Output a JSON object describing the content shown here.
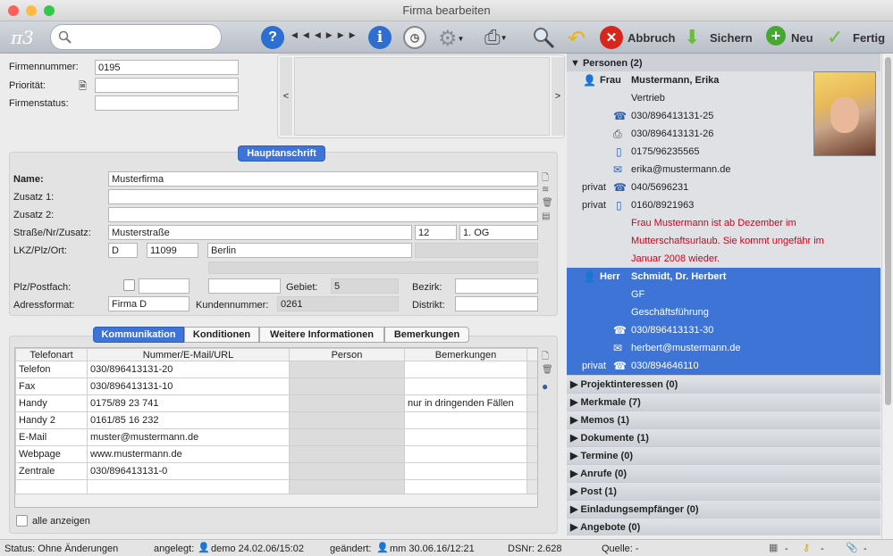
{
  "window": {
    "title": "Firma bearbeiten"
  },
  "toolbar": {
    "logo": "π3",
    "abort": "Abbruch",
    "save": "Sichern",
    "new": "Neu",
    "done": "Fertig"
  },
  "form": {
    "firmennummer_label": "Firmennummer:",
    "firmennummer": "0195",
    "prioritaet_label": "Priorität:",
    "prioritaet": "",
    "firmenstatus_label": "Firmenstatus:",
    "firmenstatus": "",
    "carousel_prev": "<",
    "carousel_next": ">"
  },
  "address": {
    "header": "Hauptanschrift",
    "name_label": "Name:",
    "name": "Musterfirma",
    "zusatz1_label": "Zusatz 1:",
    "zusatz2_label": "Zusatz 2:",
    "strasse_label": "Straße/Nr/Zusatz:",
    "strasse": "Musterstraße",
    "nr": "12",
    "zusatz": "1. OG",
    "lkz_label": "LKZ/Plz/Ort:",
    "lkz": "D",
    "plz": "11099",
    "ort": "Berlin",
    "postfach_label": "Plz/Postfach:",
    "gebiet_label": "Gebiet:",
    "gebiet": "5",
    "bezirk_label": "Bezirk:",
    "format_label": "Adressformat:",
    "format": "Firma D",
    "kundennr_label": "Kundennummer:",
    "kundennr": "0261",
    "distrikt_label": "Distrikt:"
  },
  "tabs": [
    "Kommunikation",
    "Konditionen",
    "Weitere Informationen",
    "Bemerkungen"
  ],
  "comm": {
    "headers": [
      "Telefonart",
      "Nummer/E-Mail/URL",
      "Person",
      "Bemerkungen"
    ],
    "rows": [
      [
        "Telefon",
        "030/896413131-20",
        "",
        ""
      ],
      [
        "Fax",
        "030/896413131-10",
        "",
        ""
      ],
      [
        "Handy",
        "0175/89 23 741",
        "",
        "nur in dringenden Fällen"
      ],
      [
        "Handy 2",
        "0161/85 16 232",
        "",
        ""
      ],
      [
        "E-Mail",
        "muster@mustermann.de",
        "",
        ""
      ],
      [
        "Webpage",
        "www.mustermann.de",
        "",
        ""
      ],
      [
        "Zentrale",
        "030/896413131-0",
        "",
        ""
      ],
      [
        "",
        "",
        "",
        ""
      ]
    ],
    "show_all": "alle anzeigen"
  },
  "persons": {
    "header": "Personen (2)",
    "p1": {
      "salutation": "Frau",
      "name": "Mustermann, Erika",
      "dept": "Vertrieb",
      "phone": "030/896413131-25",
      "fax": "030/896413131-26",
      "mobile": "0175/96235565",
      "email": "erika@mustermann.de",
      "priv_label": "privat",
      "priv_phone": "040/5696231",
      "priv_mobile": "0160/8921963",
      "note1": "Frau Mustermann ist ab Dezember im",
      "note2": "Mutterschaftsurlaub. Sie kommt ungefähr im",
      "note3": "Januar 2008 wieder."
    },
    "p2": {
      "salutation": "Herr",
      "name": "Schmidt, Dr. Herbert",
      "role": "GF",
      "dept": "Geschäftsführung",
      "phone": "030/896413131-30",
      "email": "herbert@mustermann.de",
      "priv_label": "privat",
      "priv_phone": "030/894646110"
    }
  },
  "sections": [
    "Projektinteressen (0)",
    "Merkmale (7)",
    "Memos (1)",
    "Dokumente (1)",
    "Termine (0)",
    "Anrufe (0)",
    "Post (1)",
    "Einladungsempfänger (0)",
    "Angebote (0)"
  ],
  "status": {
    "status": "Status:  Ohne Änderungen",
    "created_label": "angelegt:",
    "created": "demo 24.02.06/15:02",
    "changed_label": "geändert:",
    "changed": "mm 30.06.16/12:21",
    "dsnr": "DSNr: 2.628",
    "quelle": "Quelle: -",
    "dash1": "-",
    "dash2": "-",
    "dash3": "-"
  },
  "colors": {
    "accent": "#3d74d6",
    "selected": "#3d74d6",
    "note": "#d0021b"
  }
}
